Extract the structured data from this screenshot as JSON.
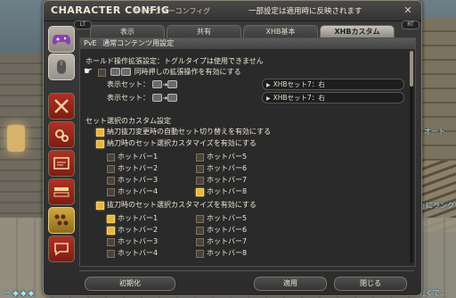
{
  "window": {
    "title": "CHARACTER CONFIG",
    "subtitle": "キャラクターコンフィグ",
    "notice": "一部設定は適用時に反映されます",
    "pill_left": "LT",
    "pill_right": "RT"
  },
  "tabs": [
    {
      "label": "表示",
      "active": false
    },
    {
      "label": "共有",
      "active": false
    },
    {
      "label": "XHB基本",
      "active": false
    },
    {
      "label": "XHBカスタム",
      "active": true
    }
  ],
  "section": {
    "mode": "PvE",
    "label": "通常コンテンツ用設定"
  },
  "hold": {
    "notice": "ホールド操作拡張設定：トグルタイプは使用できません",
    "checkbox_label": "同時押しの拡張操作を有効にする",
    "checked": false,
    "rows": [
      {
        "label": "表示セット：",
        "value": "XHBセット7：右"
      },
      {
        "label": "表示セット：",
        "value": "XHBセット7：右"
      }
    ]
  },
  "set_select": {
    "heading": "セット選択のカスタム設定",
    "auto_switch": {
      "label": "納刀抜刀変更時の自動セット切り替えを有効にする",
      "checked": true
    },
    "sheathed": {
      "label": "納刀時のセット選択カスタマイズを有効にする",
      "checked": true,
      "items": [
        {
          "label": "ホットバー1",
          "checked": false
        },
        {
          "label": "ホットバー5",
          "checked": false
        },
        {
          "label": "ホットバー2",
          "checked": false
        },
        {
          "label": "ホットバー6",
          "checked": false
        },
        {
          "label": "ホットバー3",
          "checked": false
        },
        {
          "label": "ホットバー7",
          "checked": false
        },
        {
          "label": "ホットバー4",
          "checked": false
        },
        {
          "label": "ホットバー8",
          "checked": true
        }
      ]
    },
    "drawn": {
      "label": "抜刀時のセット選択カスタマイズを有効にする",
      "checked": true,
      "items": [
        {
          "label": "ホットバー1",
          "checked": true
        },
        {
          "label": "ホットバー5",
          "checked": false
        },
        {
          "label": "ホットバー2",
          "checked": true
        },
        {
          "label": "ホットバー6",
          "checked": false
        },
        {
          "label": "ホットバー3",
          "checked": false
        },
        {
          "label": "ホットバー7",
          "checked": false
        },
        {
          "label": "ホットバー4",
          "checked": false
        },
        {
          "label": "ホットバー8",
          "checked": false
        }
      ]
    }
  },
  "footer": {
    "reset": "初期化",
    "apply": "適用",
    "close": "閉じる"
  },
  "scene_text": {
    "right_1": "オート",
    "right_2": "ジョにランク",
    "bottom_left": "ー ◆ ◆ ◆",
    "bottom_right": "近くで…"
  },
  "colors": {
    "check_on": "#e9b53d",
    "tab_active": "#c8c4bc",
    "rail_red": "#b03024",
    "rail_gold": "#d1a741"
  },
  "icons": {
    "close": "close-icon",
    "gamepad": "gamepad-icon",
    "mouse": "mouse-icon",
    "hand_cursor": "pointing-hand-icon"
  }
}
